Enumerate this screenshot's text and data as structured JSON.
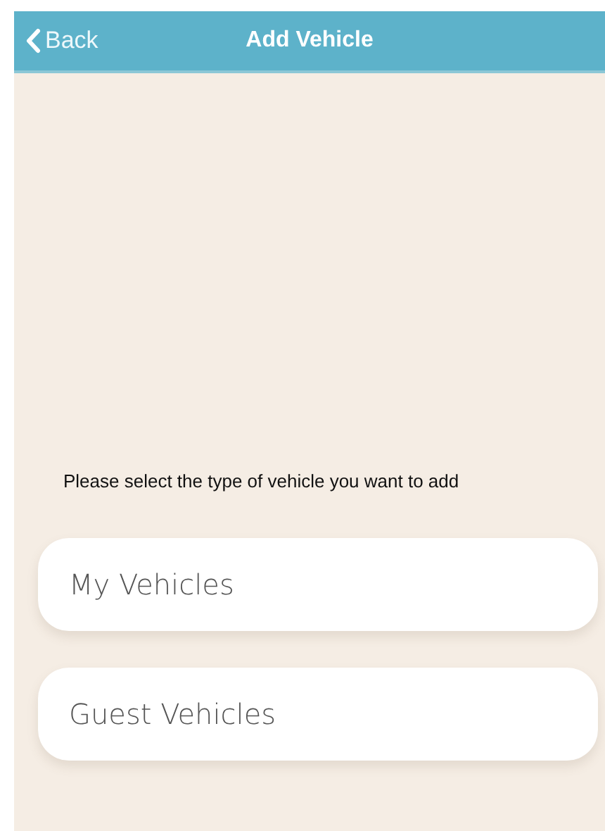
{
  "header": {
    "back_label": "Back",
    "title": "Add Vehicle"
  },
  "prompt": "Please select the type of vehicle you want to add",
  "options": [
    {
      "label": "My Vehicles"
    },
    {
      "label": "Guest Vehicles"
    }
  ]
}
